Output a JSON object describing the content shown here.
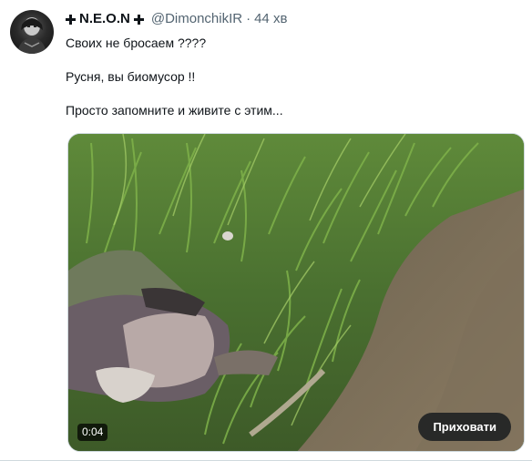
{
  "tweet": {
    "display_name": "N.E.O.N",
    "handle": "@DimonchikIR",
    "separator": "·",
    "time": "44 хв",
    "lines": [
      "Своих не бросаем ????",
      "Русня, вы биомусор  !!",
      "Просто запомните и живите с этим..."
    ]
  },
  "media": {
    "duration": "0:04",
    "hide_button_label": "Приховати"
  },
  "icons": {
    "name_prefix": "cross-icon",
    "name_suffix": "cross-icon"
  },
  "colors": {
    "text_primary": "#0f1419",
    "text_secondary": "#536471",
    "border": "#cfd9de",
    "overlay_button": "#0f1419"
  }
}
